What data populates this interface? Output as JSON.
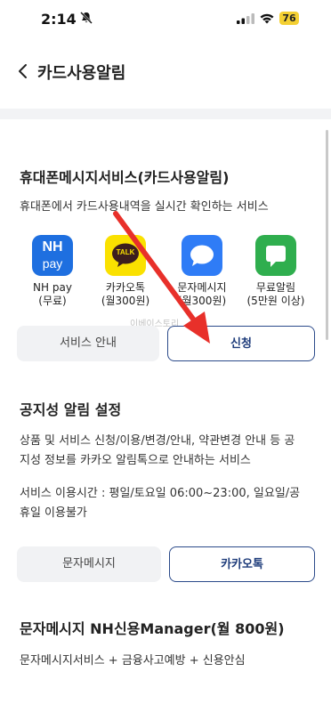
{
  "status_bar": {
    "time": "2:14",
    "battery": "76"
  },
  "header": {
    "title": "카드사용알림"
  },
  "section1": {
    "title": "휴대폰메시지서비스(카드사용알림)",
    "description": "휴대폰에서 카드사용내역을 실시간 확인하는 서비스",
    "apps": [
      {
        "name": "NH pay",
        "sub": "(무료)",
        "icon": "nh-pay-icon",
        "icon_text_top": "NH",
        "icon_text_bottom": "pay",
        "color": "#1e6fe0"
      },
      {
        "name": "카카오톡",
        "sub": "(월300원)",
        "icon": "kakaotalk-icon",
        "icon_text": "TALK",
        "color": "#fae100"
      },
      {
        "name": "문자메시지",
        "sub": "(월300원)",
        "icon": "sms-icon",
        "color": "#2f7cf6"
      },
      {
        "name": "무료알림",
        "sub": "(5만원 이상)",
        "icon": "free-alert-icon",
        "color": "#2fae4e"
      }
    ],
    "btn_service_info": "서비스 안내",
    "btn_apply": "신청"
  },
  "watermark": "이베이스토리",
  "section2": {
    "title": "공지성 알림 설정",
    "desc_line1": "상품 및 서비스 신청/이용/변경/안내, 약관변경 안내 등 공",
    "desc_line2": "지성 정보를 카카오 알림톡으로 안내하는 서비스",
    "hours_line1": "서비스 이용시간 : 평일/토요일 06:00~23:00, 일요일/공",
    "hours_line2": "휴일 이용불가",
    "btn_sms": "문자메시지",
    "btn_kakao": "카카오톡"
  },
  "section3": {
    "title": "문자메시지 NH신용Manager(월 800원)",
    "desc": "문자메시지서비스 + 금융사고예방 + 신용안심"
  },
  "colors": {
    "accent": "#1d3b7a",
    "annotation_arrow": "#e8302a"
  }
}
